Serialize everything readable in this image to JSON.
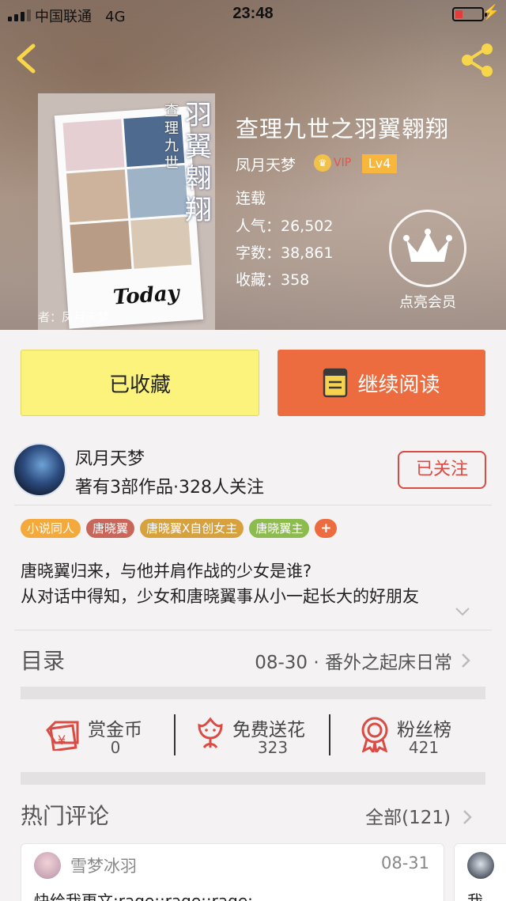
{
  "status_bar": {
    "carrier": "中国联通",
    "network": "4G",
    "time": "23:48",
    "battery_level": 0.15
  },
  "book": {
    "title": "查理九世之羽翼翱翔",
    "author": "凤月天梦",
    "vip_label": "VIP",
    "level": "Lv4",
    "status": "连载",
    "popularity": "人气：26,502",
    "word_count": "字数：38,861",
    "favorites": "收藏：358",
    "cover": {
      "vertical_title": "羽翼翱翔",
      "vertical_subtitle": "查理九世",
      "today_text": "Today",
      "author_credit": "者：凤月天梦"
    }
  },
  "vip_member": {
    "label": "点亮会员",
    "icon": "crown-icon"
  },
  "actions": {
    "favorited_label": "已收藏",
    "continue_read_label": "继续阅读",
    "colors": {
      "favorited_bg": "#fbf37b",
      "read_bg": "#ec6c3f"
    }
  },
  "author_info": {
    "name": "凤月天梦",
    "stats": "著有3部作品·328人关注",
    "follow_label": "已关注"
  },
  "tags": [
    {
      "label": "小说同人",
      "color": "#f3a93b"
    },
    {
      "label": "唐晓翼",
      "color": "#c9665a"
    },
    {
      "label": "唐晓翼X自创女主",
      "color": "#d7a13d"
    },
    {
      "label": "唐晓翼主",
      "color": "#8cbb4e"
    },
    {
      "label": "+",
      "color": "#ec6c3f"
    }
  ],
  "description": {
    "line1": "唐晓翼归来，与他并肩作战的少女是谁?",
    "line2": "从对话中得知，少女和唐晓翼事从小一起长大的好朋友"
  },
  "toc": {
    "title": "目录",
    "latest": "08-30 · 番外之起床日常"
  },
  "gifts": [
    {
      "label": "赏金币",
      "count": "0",
      "icon": "red-envelope-icon"
    },
    {
      "label": "免费送花",
      "count": "323",
      "icon": "flower-icon"
    },
    {
      "label": "粉丝榜",
      "count": "421",
      "icon": "medal-icon"
    }
  ],
  "hot_comments": {
    "title": "热门评论",
    "all_label": "全部(121)",
    "items": [
      {
        "user": "雪梦冰羽",
        "date": "08-31",
        "text": "快给我更文:rage::rage::rage:"
      },
      {
        "text": "我"
      }
    ]
  }
}
